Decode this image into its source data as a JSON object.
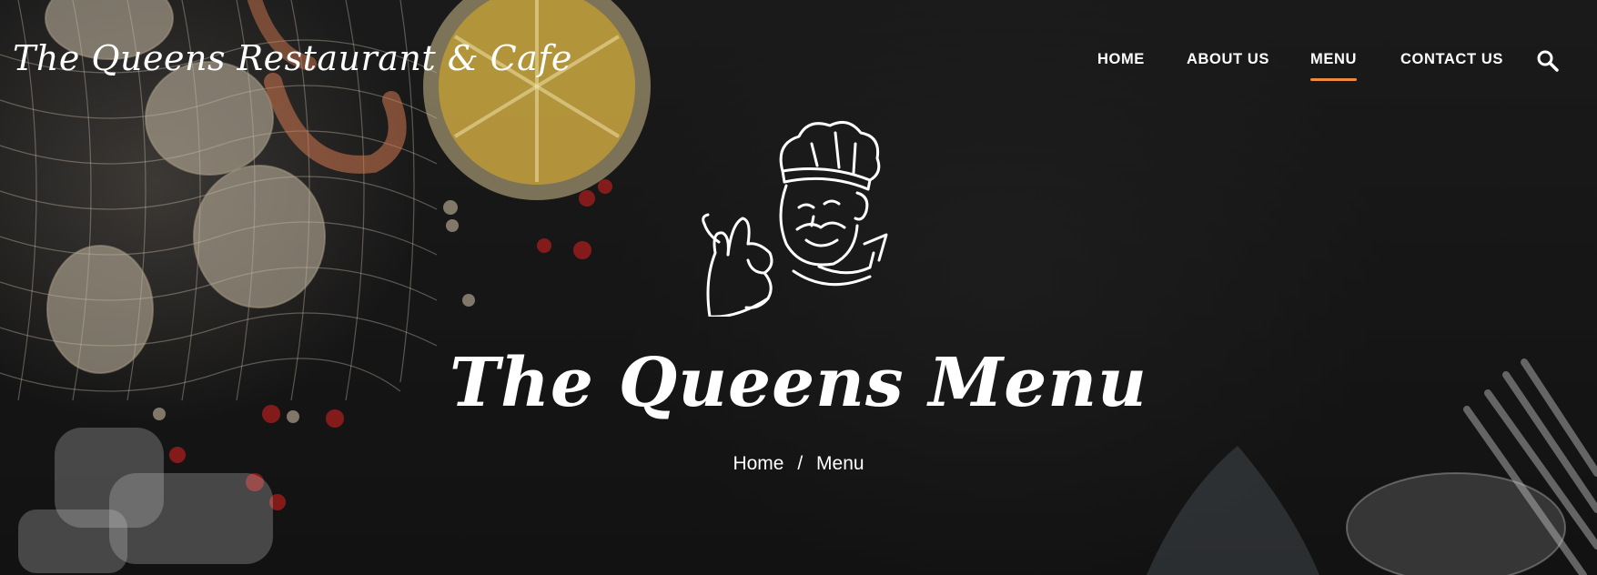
{
  "site": {
    "title": "The Queens Restaurant & Cafe"
  },
  "nav": {
    "items": [
      {
        "label": "HOME"
      },
      {
        "label": "ABOUT US"
      },
      {
        "label": "MENU",
        "active": true
      },
      {
        "label": "CONTACT US"
      }
    ],
    "search_icon": "search-icon",
    "active_underline_color": "#f08a3c"
  },
  "hero": {
    "logo_icon": "chef-okay-gesture-icon",
    "title": "The Queens Menu"
  },
  "breadcrumb": {
    "home": "Home",
    "separator": "/",
    "current": "Menu"
  }
}
